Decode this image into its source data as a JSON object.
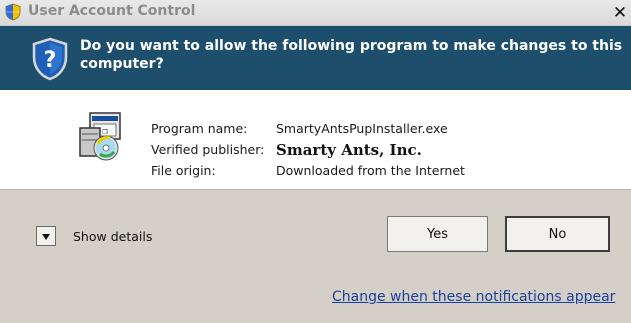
{
  "window": {
    "title": "User Account Control",
    "close_symbol": "✕"
  },
  "banner": {
    "question": "Do you want to allow the following program to make changes to this computer?",
    "icon": "uac-question-shield-icon"
  },
  "program": {
    "icon": "installer-package-icon",
    "fields": [
      {
        "label": "Program name:",
        "value": "SmartyAntsPupInstaller.exe"
      },
      {
        "label": "Verified publisher:",
        "value": "Smarty Ants, Inc."
      },
      {
        "label": "File origin:",
        "value": "Downloaded from the Internet"
      }
    ]
  },
  "footer": {
    "show_details_label": "Show details",
    "yes_label": "Yes",
    "no_label": "No",
    "change_link": "Change when these notifications appear"
  },
  "colors": {
    "banner_bg": "#1d4f6c",
    "link": "#1a3fa0",
    "footer_bg": "#d4d0c8"
  }
}
